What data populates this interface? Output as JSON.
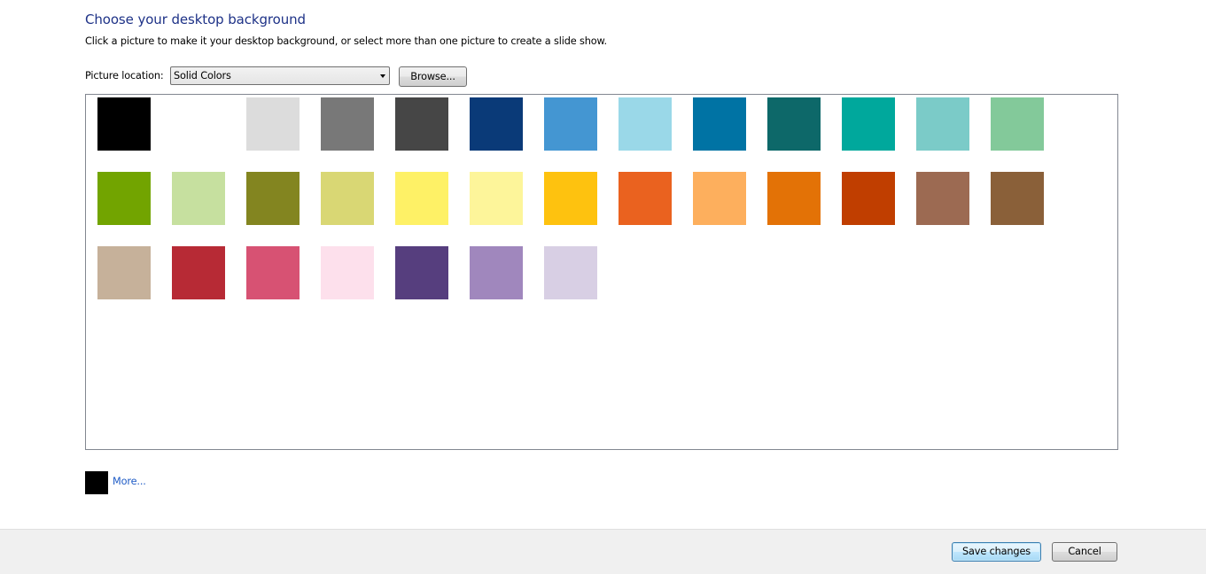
{
  "header": {
    "title": "Choose your desktop background",
    "subtitle": "Click a picture to make it your desktop background, or select more than one picture to create a slide show."
  },
  "picture_location": {
    "label": "Picture location:",
    "selected": "Solid Colors",
    "browse_label": "Browse..."
  },
  "swatches": [
    [
      "#000000",
      "#ffffff",
      "#dcdcdc",
      "#787878",
      "#464646",
      "#0a3a78",
      "#4496d2",
      "#9ad8e8",
      "#0073a4",
      "#0d6869",
      "#00a89c",
      "#7bcbc8",
      "#83c99a"
    ],
    [
      "#72a400",
      "#c6e09f",
      "#838520",
      "#d9d774",
      "#fef166",
      "#fdf59a",
      "#fec20f",
      "#ea621f",
      "#fdaf5d",
      "#e37206",
      "#c03e00",
      "#9c6a52",
      "#8a6039"
    ],
    [
      "#c6b19a",
      "#b72a35",
      "#d75273",
      "#fde0ec",
      "#563e7e",
      "#a087bd",
      "#d8cfe4"
    ]
  ],
  "current_color": {
    "swatch": "#000000",
    "more_label": "More..."
  },
  "footer": {
    "save_label": "Save changes",
    "cancel_label": "Cancel"
  }
}
